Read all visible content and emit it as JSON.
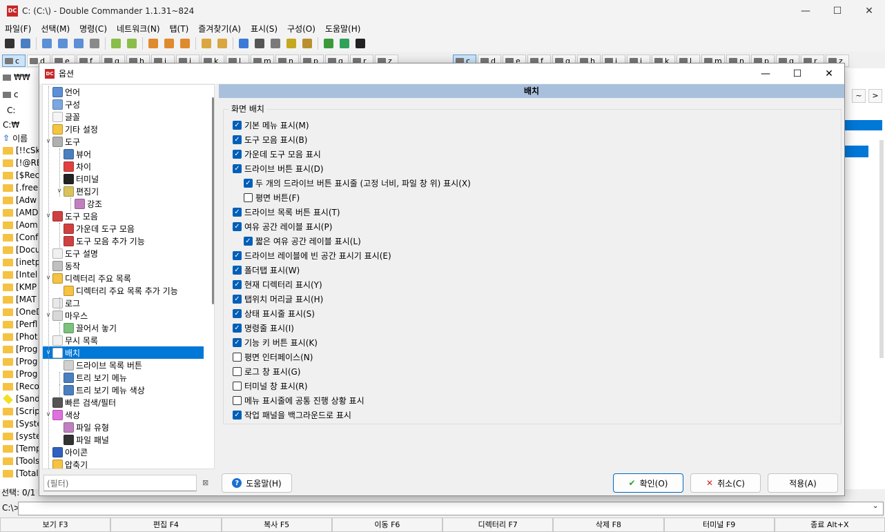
{
  "window": {
    "title": "C: (C:\\) - Double Commander 1.1.31~824",
    "icon_text": "DC",
    "minimize": "—",
    "maximize": "☐",
    "close": "✕"
  },
  "menu": [
    "파일(F)",
    "선택(M)",
    "명령(C)",
    "네트워크(N)",
    "탭(T)",
    "즐겨찾기(A)",
    "표시(S)",
    "구성(O)",
    "도움말(H)"
  ],
  "toolbar_icons": [
    "terminal-icon",
    "gear-icon",
    "brief-view-icon",
    "full-view-icon",
    "thumb-view-icon",
    "compare-icon",
    "copy-left-icon",
    "copy-right-icon",
    "multirename-icon",
    "search-icon",
    "sync-icon",
    "pack-icon",
    "unpack-icon",
    "view-icon",
    "binoculars-icon",
    "edit-icon",
    "notepad-icon",
    "copy-names-icon",
    "refresh-icon",
    "book-icon",
    "7zip-icon"
  ],
  "drives_left": [
    {
      "label": "c",
      "sel": true
    },
    {
      "label": "d"
    },
    {
      "label": "e"
    },
    {
      "label": "f"
    },
    {
      "label": "g"
    },
    {
      "label": "h"
    },
    {
      "label": "i"
    },
    {
      "label": "j"
    },
    {
      "label": "k"
    },
    {
      "label": "l"
    },
    {
      "label": "m"
    },
    {
      "label": "n"
    },
    {
      "label": "p"
    },
    {
      "label": "q"
    },
    {
      "label": "r"
    },
    {
      "label": "z"
    }
  ],
  "drives_right": [
    {
      "label": "c",
      "sel": true
    },
    {
      "label": "d"
    },
    {
      "label": "e"
    },
    {
      "label": "f"
    },
    {
      "label": "g"
    },
    {
      "label": "h"
    },
    {
      "label": "i"
    },
    {
      "label": "j"
    },
    {
      "label": "k"
    },
    {
      "label": "l"
    },
    {
      "label": "m"
    },
    {
      "label": "n"
    },
    {
      "label": "p"
    },
    {
      "label": "q"
    },
    {
      "label": "r"
    },
    {
      "label": "z"
    }
  ],
  "left_panel": {
    "drive_label": "₩₩",
    "tab_label": "c",
    "path_label": "C:",
    "path": "C:₩",
    "column": "이름",
    "files": [
      "[!!cSk",
      "[!@RE",
      "[$Rec",
      "[.free",
      "[Adw",
      "[AMD",
      "[Aom",
      "[Conf",
      "[Docu",
      "[inetp",
      "[Intel",
      "[KMP",
      "[MAT",
      "[OneD",
      "[Perfl",
      "[Phot",
      "[Prog",
      "[Prog",
      "[Prog",
      "[Reco",
      "[Sand",
      "[Scrip",
      "[Syste",
      "[syste",
      "[Temp",
      "[Tools",
      "[Total"
    ],
    "status": "선택: 0/1"
  },
  "right_panel": {
    "nav_back": "~",
    "nav_next": ">"
  },
  "cmdline": {
    "prompt": "C:\\>"
  },
  "fkeys": [
    "보기 F3",
    "편집 F4",
    "복사 F5",
    "이동 F6",
    "디렉터리 F7",
    "삭제 F8",
    "터미널 F9",
    "종료 Alt+X"
  ],
  "dialog": {
    "title": "옵션",
    "tree": [
      {
        "label": "언어",
        "level": 0,
        "icon": "#5b8fd6"
      },
      {
        "label": "구성",
        "level": 0,
        "icon": "#7aa7e0"
      },
      {
        "label": "글꼴",
        "level": 0,
        "icon": "#f5f5f5"
      },
      {
        "label": "기타 설정",
        "level": 0,
        "icon": "#f5c542"
      },
      {
        "label": "도구",
        "level": 0,
        "icon": "#b0b0b0",
        "expand": "∨"
      },
      {
        "label": "뷰어",
        "level": 1,
        "icon": "#4a7fc1"
      },
      {
        "label": "차이",
        "level": 1,
        "icon": "#e04040"
      },
      {
        "label": "터미널",
        "level": 1,
        "icon": "#222222"
      },
      {
        "label": "편집기",
        "level": 1,
        "icon": "#d9c25e",
        "expand": "∨"
      },
      {
        "label": "강조",
        "level": 2,
        "icon": "#c080c0"
      },
      {
        "label": "도구 모음",
        "level": 0,
        "icon": "#d04040",
        "expand": "∨"
      },
      {
        "label": "가운데 도구 모음",
        "level": 1,
        "icon": "#d04040"
      },
      {
        "label": "도구 모음 추가 기능",
        "level": 1,
        "icon": "#d04040"
      },
      {
        "label": "도구 설명",
        "level": 0,
        "icon": "#f0f0f0"
      },
      {
        "label": "동작",
        "level": 0,
        "icon": "#c0c0c0"
      },
      {
        "label": "디렉터리 주요 목록",
        "level": 0,
        "icon": "#f5c242",
        "expand": "∨"
      },
      {
        "label": "디렉터리 주요 목록 추가 기능",
        "level": 1,
        "icon": "#f5c242"
      },
      {
        "label": "로그",
        "level": 0,
        "icon": "#e8e8e8"
      },
      {
        "label": "마우스",
        "level": 0,
        "icon": "#d8d8d8",
        "expand": "∨"
      },
      {
        "label": "끌어서 놓기",
        "level": 1,
        "icon": "#7cc27c"
      },
      {
        "label": "무시 목록",
        "level": 0,
        "icon": "#f0f0f0"
      },
      {
        "label": "배치",
        "level": 0,
        "icon": "#ffffff",
        "expand": "∨",
        "selected": true
      },
      {
        "label": "드라이브 목록 버튼",
        "level": 1,
        "icon": "#d0d0d0"
      },
      {
        "label": "트리 보기 메뉴",
        "level": 1,
        "icon": "#4a7fc1"
      },
      {
        "label": "트리 보기 메뉴 색상",
        "level": 1,
        "icon": "#4a7fc1"
      },
      {
        "label": "빠른 검색/필터",
        "level": 0,
        "icon": "#555555"
      },
      {
        "label": "색상",
        "level": 0,
        "icon": "#e070e0",
        "expand": "∨"
      },
      {
        "label": "파일 유형",
        "level": 1,
        "icon": "#c080c0"
      },
      {
        "label": "파일 패널",
        "level": 1,
        "icon": "#333333"
      },
      {
        "label": "아이콘",
        "level": 0,
        "icon": "#3060c0"
      },
      {
        "label": "압축기",
        "level": 0,
        "icon": "#f5c242"
      }
    ],
    "filter_placeholder": "(필터)",
    "help_button": "도움말(H)",
    "ok_button": "확인(O)",
    "cancel_button": "취소(C)",
    "apply_button": "적용(A)",
    "section_header": "배치",
    "group_title": "화면 배치",
    "options": [
      {
        "label": "기본 메뉴 표시(M)",
        "checked": true,
        "level": 0
      },
      {
        "label": "도구 모음 표시(B)",
        "checked": true,
        "level": 0
      },
      {
        "label": "가운데 도구 모음 표시",
        "checked": true,
        "level": 0
      },
      {
        "label": "드라이브 버튼 표시(D)",
        "checked": true,
        "level": 0
      },
      {
        "label": "두 개의 드라이브 버튼 표시줄 (고정 너비, 파일 창 위) 표시(X)",
        "checked": true,
        "level": 1
      },
      {
        "label": "평면 버튼(F)",
        "checked": false,
        "level": 1
      },
      {
        "label": "드라이브 목록 버튼 표시(T)",
        "checked": true,
        "level": 0
      },
      {
        "label": "여유 공간 레이블 표시(P)",
        "checked": true,
        "level": 0
      },
      {
        "label": "짧은 여유 공간 레이블 표시(L)",
        "checked": true,
        "level": 1
      },
      {
        "label": "드라이브 레이블에 빈 공간 표시기 표시(E)",
        "checked": true,
        "level": 0
      },
      {
        "label": "폴더탭 표시(W)",
        "checked": true,
        "level": 0
      },
      {
        "label": "현재 디렉터리 표시(Y)",
        "checked": true,
        "level": 0
      },
      {
        "label": "탭위치 머리글 표시(H)",
        "checked": true,
        "level": 0
      },
      {
        "label": "상태 표시줄 표시(S)",
        "checked": true,
        "level": 0
      },
      {
        "label": "명령줄 표시(I)",
        "checked": true,
        "level": 0
      },
      {
        "label": "기능 키 버튼 표시(K)",
        "checked": true,
        "level": 0
      },
      {
        "label": "평면 인터페이스(N)",
        "checked": false,
        "level": 0
      },
      {
        "label": "로그 창 표시(G)",
        "checked": false,
        "level": 0
      },
      {
        "label": "터미널 창 표시(R)",
        "checked": false,
        "level": 0
      },
      {
        "label": "메뉴 표시줄에 공통 진행 상황 표시",
        "checked": false,
        "level": 0
      },
      {
        "label": "작업 패널을 백그라운드로 표시",
        "checked": true,
        "level": 0
      }
    ]
  }
}
